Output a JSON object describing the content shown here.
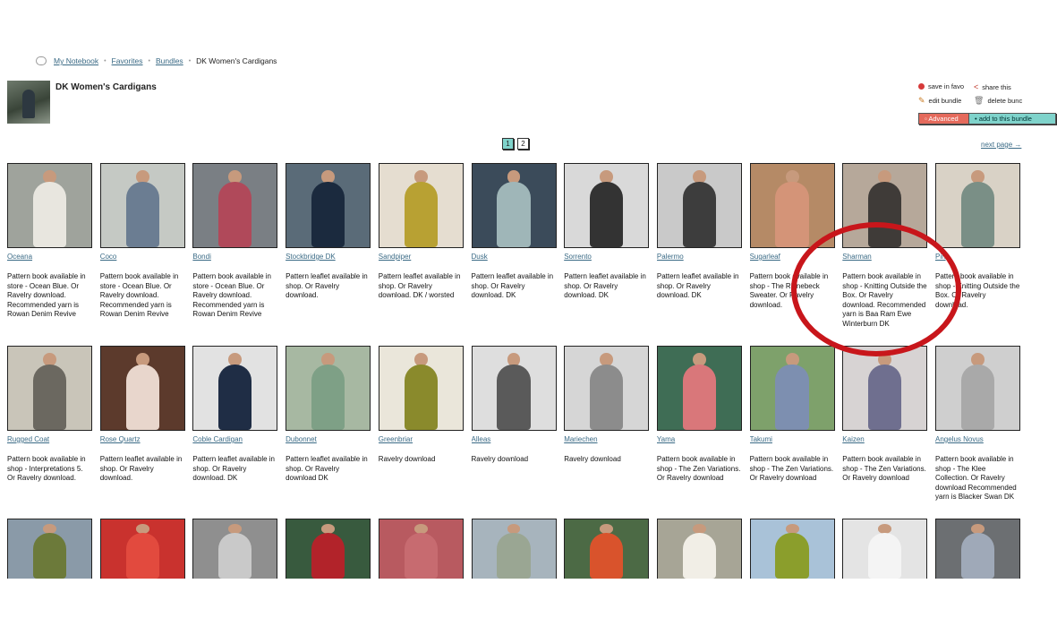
{
  "breadcrumb": {
    "items": [
      "My Notebook",
      "Favorites",
      "Bundles"
    ],
    "current": "DK Women's Cardigans"
  },
  "bundle": {
    "title": "DK Women's Cardigans"
  },
  "actions": {
    "save": "save in favo",
    "share": "share this",
    "edit": "edit bundle",
    "delete": "delete bunc",
    "advanced": "Advanced",
    "add": "add to this bundle"
  },
  "pagination": {
    "pages": [
      "1",
      "2"
    ],
    "current": "1",
    "next": "next page →"
  },
  "colors": {
    "link": "#3b6b86",
    "accent_teal": "#7fd3cb",
    "accent_red": "#e56a5c",
    "annotation": "#c8161b"
  },
  "rows": [
    [
      {
        "name": "Oceana",
        "desc": "Pattern book available in store - Ocean Blue. Or Ravelry download. Recommended yarn is Rowan Denim Revive",
        "bg": "#9fa39c",
        "fg": "#e8e6df"
      },
      {
        "name": "Coco",
        "desc": "Pattern book available in store - Ocean Blue. Or Ravelry download. Recommended yarn is Rowan Denim Revive",
        "bg": "#c5c9c4",
        "fg": "#6b7d92"
      },
      {
        "name": "Bondi",
        "desc": "Pattern book available in store - Ocean Blue. Or Ravelry download. Recommended yarn is Rowan Denim Revive",
        "bg": "#7a7f84",
        "fg": "#b0495a"
      },
      {
        "name": "Stockbridge DK",
        "desc": "Pattern leaflet available in shop. Or Ravelry download.",
        "bg": "#5a6b78",
        "fg": "#1b2a3e"
      },
      {
        "name": "Sandpiper",
        "desc": "Pattern leaflet available in shop. Or Ravelry download. DK / worsted",
        "bg": "#e5ddd0",
        "fg": "#b8a133"
      },
      {
        "name": "Dusk",
        "desc": "Pattern leaflet available in shop. Or Ravelry download. DK",
        "bg": "#3b4b5a",
        "fg": "#9fb6b8"
      },
      {
        "name": "Sorrento",
        "desc": "Pattern leaflet available in shop. Or Ravelry download. DK",
        "bg": "#d9d9d9",
        "fg": "#333333"
      },
      {
        "name": "Palermo",
        "desc": "Pattern leaflet available in shop. Or Ravelry download. DK",
        "bg": "#c9c9c9",
        "fg": "#3d3d3d"
      },
      {
        "name": "Sugarleaf",
        "desc": "Pattern book available in shop - The Rhinebeck Sweater. Or Ravelry download.",
        "bg": "#b58a66",
        "fg": "#d49478"
      },
      {
        "name": "Sharman",
        "desc": "Pattern book available in shop - Knitting Outside the Box. Or Ravelry download. Recommended yarn is Baa Ram Ewe Winterburn DK",
        "bg": "#b6a89a",
        "fg": "#3f3b38"
      },
      {
        "name": "Pin",
        "desc": "Pattern book available in shop - Knitting Outside the Box. Or Ravelry download.",
        "bg": "#d9d2c6",
        "fg": "#7a8f86"
      }
    ],
    [
      {
        "name": "Rugged Coat",
        "desc": "Pattern book available in shop - Interpretations 5. Or Ravelry download.",
        "bg": "#c9c5b9",
        "fg": "#6b6860"
      },
      {
        "name": "Rose Quartz",
        "desc": "Pattern leaflet available in shop. Or Ravelry download.",
        "bg": "#5c3a2c",
        "fg": "#e8d6cc"
      },
      {
        "name": "Coble Cardigan",
        "desc": "Pattern leaflet available in shop. Or Ravelry download. DK",
        "bg": "#e2e2e2",
        "fg": "#1f2d45"
      },
      {
        "name": "Dubonnet",
        "desc": "Pattern leaflet available in shop. Or Ravelry download DK",
        "bg": "#a7b8a2",
        "fg": "#7ea086"
      },
      {
        "name": "Greenbriar",
        "desc": "Ravelry download",
        "bg": "#eae6da",
        "fg": "#8a8a2c"
      },
      {
        "name": "Alleas",
        "desc": "Ravelry download",
        "bg": "#dedede",
        "fg": "#5a5a5a"
      },
      {
        "name": "Mariechen",
        "desc": "Ravelry download",
        "bg": "#d6d6d6",
        "fg": "#8c8c8c"
      },
      {
        "name": "Yama",
        "desc": "Pattern book available in shop - The Zen Variations. Or Ravelry download",
        "bg": "#3f6d55",
        "fg": "#d9777a"
      },
      {
        "name": "Takumi",
        "desc": "Pattern book available in shop - The Zen Variations. Or Ravelry download",
        "bg": "#7ea16b",
        "fg": "#7d8fb0"
      },
      {
        "name": "Kaizen",
        "desc": "Pattern book available in shop - The Zen Variations. Or Ravelry download",
        "bg": "#d7d3d3",
        "fg": "#6f6f8f"
      },
      {
        "name": "Angelus Novus",
        "desc": "Pattern book available in shop - The Klee Collection. Or Ravelry download Recommended yarn is Blacker Swan DK",
        "bg": "#cfcfcf",
        "fg": "#a9a9a9"
      }
    ],
    [
      {
        "name": "",
        "desc": "",
        "bg": "#8a9aa8",
        "fg": "#6c7a3a"
      },
      {
        "name": "",
        "desc": "",
        "bg": "#c9322e",
        "fg": "#e24a3e"
      },
      {
        "name": "",
        "desc": "",
        "bg": "#8f8f8f",
        "fg": "#c9c9c9"
      },
      {
        "name": "",
        "desc": "",
        "bg": "#385a3e",
        "fg": "#b2232a"
      },
      {
        "name": "",
        "desc": "",
        "bg": "#b85a60",
        "fg": "#c76b70"
      },
      {
        "name": "",
        "desc": "",
        "bg": "#a7b4bd",
        "fg": "#9aa693"
      },
      {
        "name": "",
        "desc": "",
        "bg": "#4c6a45",
        "fg": "#d9532c"
      },
      {
        "name": "",
        "desc": "",
        "bg": "#a7a596",
        "fg": "#f1eee6"
      },
      {
        "name": "",
        "desc": "",
        "bg": "#a9c2d8",
        "fg": "#8b9e2c"
      },
      {
        "name": "",
        "desc": "",
        "bg": "#e4e4e4",
        "fg": "#f4f4f4"
      },
      {
        "name": "",
        "desc": "",
        "bg": "#6c6f72",
        "fg": "#9fa9b8"
      }
    ]
  ]
}
